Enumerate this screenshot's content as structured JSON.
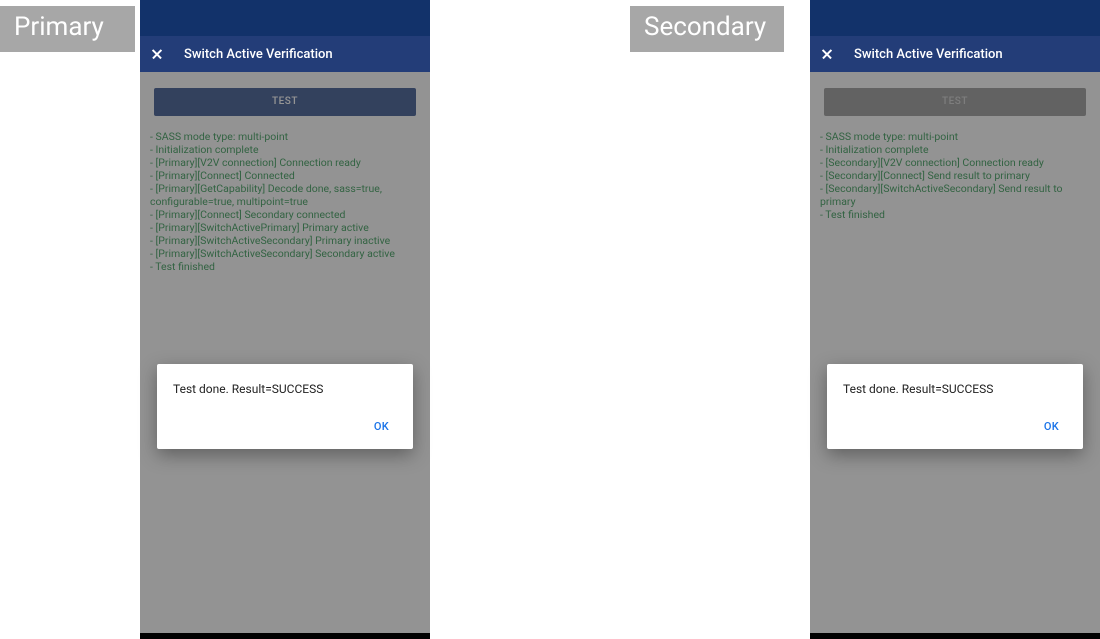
{
  "tags": {
    "primary": "Primary",
    "secondary": "Secondary"
  },
  "app_bar": {
    "title": "Switch Active Verification"
  },
  "button": {
    "test": "TEST"
  },
  "primary_log": [
    "- SASS mode type: multi-point",
    "- Initialization complete",
    "- [Primary][V2V connection] Connection ready",
    "- [Primary][Connect] Connected",
    "- [Primary][GetCapability] Decode done, sass=true, configurable=true, multipoint=true",
    "- [Primary][Connect] Secondary connected",
    "- [Primary][SwitchActivePrimary] Primary active",
    "- [Primary][SwitchActiveSecondary] Primary inactive",
    "- [Primary][SwitchActiveSecondary] Secondary active",
    "- Test finished"
  ],
  "secondary_log": [
    "- SASS mode type: multi-point",
    "- Initialization complete",
    "- [Secondary][V2V connection] Connection ready",
    "- [Secondary][Connect] Send result to primary",
    "- [Secondary][SwitchActiveSecondary] Send result to primary",
    "- Test finished"
  ],
  "dialog": {
    "message": "Test done. Result=SUCCESS",
    "ok": "OK"
  }
}
